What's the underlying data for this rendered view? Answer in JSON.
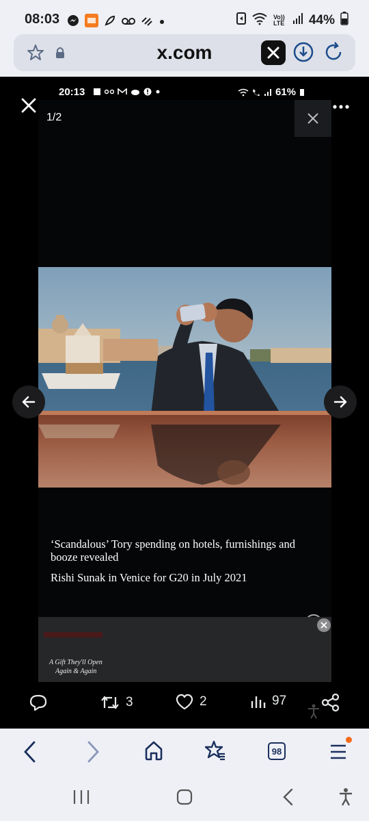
{
  "status_bar": {
    "time": "08:03",
    "battery": "44%",
    "network": "Vo)) LTE",
    "icons": [
      "messenger-icon",
      "temu-icon",
      "feather-icon",
      "voicemail-icon",
      "data-icon",
      "dot-icon",
      "nfc-icon",
      "wifi-icon",
      "signal-icon",
      "battery-icon"
    ]
  },
  "browser": {
    "url": "x.com"
  },
  "viewer": {
    "counter": "1/2",
    "inner_status": {
      "time": "20:13",
      "battery": "61%"
    },
    "headline": "‘Scandalous’ Tory spending on hotels, furnishings and booze revealed",
    "caption": "Rishi Sunak in Venice for G20 in July 2021",
    "ad": {
      "text_line1": "A Gift They'll Open",
      "text_line2": "Again & Again"
    }
  },
  "actions": {
    "reposts": "3",
    "likes": "2",
    "views": "97"
  },
  "toolbar": {
    "tab_count": "98"
  },
  "colors": {
    "chrome_bg": "#eef0f6",
    "accent_blue": "#1a2e5c",
    "notification_dot": "#f56a1a"
  }
}
